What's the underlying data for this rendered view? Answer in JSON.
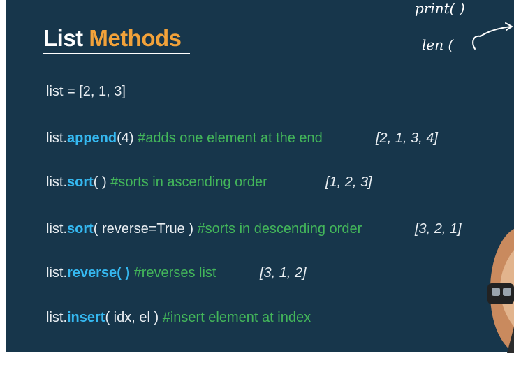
{
  "title": {
    "word1": "List",
    "word2": "Methods"
  },
  "lines": [
    {
      "text": "list = [2, 1, 3]"
    },
    {
      "prefix": "list.",
      "method": "append",
      "args": "(4)",
      "comment": "#adds one element at the end",
      "result": "[2, 1, 3, 4]"
    },
    {
      "prefix": "list.",
      "method": "sort",
      "args": "( )",
      "comment": "#sorts in ascending order",
      "result": "[1, 2, 3]"
    },
    {
      "prefix": "list.",
      "method": "sort",
      "args": "( reverse=True )",
      "comment": "#sorts in descending order",
      "result": "[3, 2, 1]"
    },
    {
      "prefix": "list.",
      "method": "reverse",
      "args": "( )",
      "comment": "#reverses list",
      "result": "[3, 1, 2]"
    },
    {
      "prefix": "list.",
      "method": "insert",
      "args": "( idx, el )",
      "comment": "#insert element at index",
      "result": ""
    }
  ],
  "handwriting": {
    "line1": "print(  )",
    "line2": "len ("
  },
  "colors": {
    "background": "#17364b",
    "method": "#35b8f0",
    "comment": "#43b65a",
    "accent": "#f2a23a"
  }
}
